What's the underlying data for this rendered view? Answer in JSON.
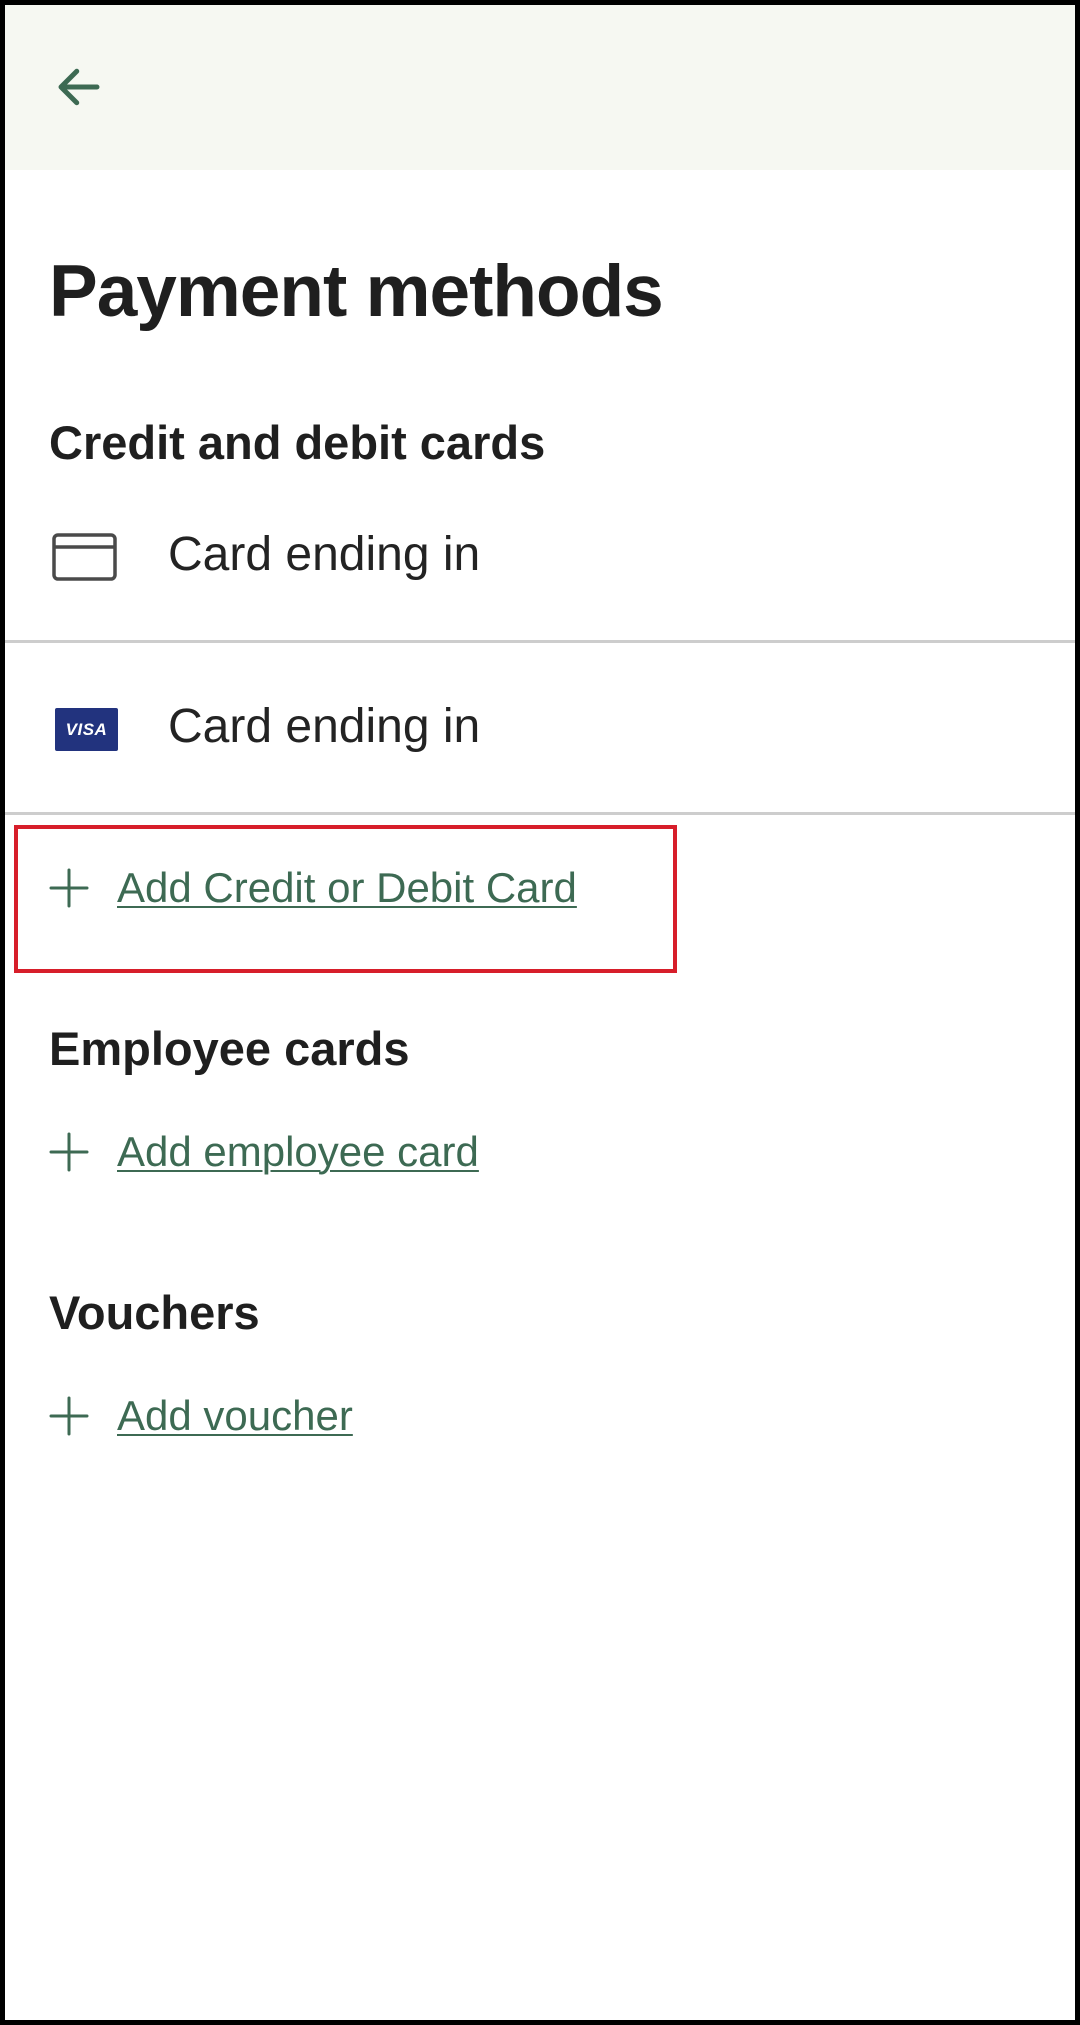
{
  "header": {
    "back_icon": "arrow-left-icon"
  },
  "page": {
    "title": "Payment methods"
  },
  "sections": {
    "cards": {
      "title": "Credit and debit cards",
      "items": [
        {
          "icon": "credit-card-icon",
          "label": "Card ending in"
        },
        {
          "icon": "visa-icon",
          "brand": "VISA",
          "label": "Card ending in"
        }
      ],
      "add_label": "Add Credit or Debit Card"
    },
    "employee": {
      "title": "Employee cards",
      "add_label": "Add employee card"
    },
    "vouchers": {
      "title": "Vouchers",
      "add_label": "Add voucher"
    }
  },
  "colors": {
    "accent": "#3d6a53",
    "header_bg": "#f6f8f2",
    "highlight": "#d71e2a",
    "visa_bg": "#22337e"
  }
}
